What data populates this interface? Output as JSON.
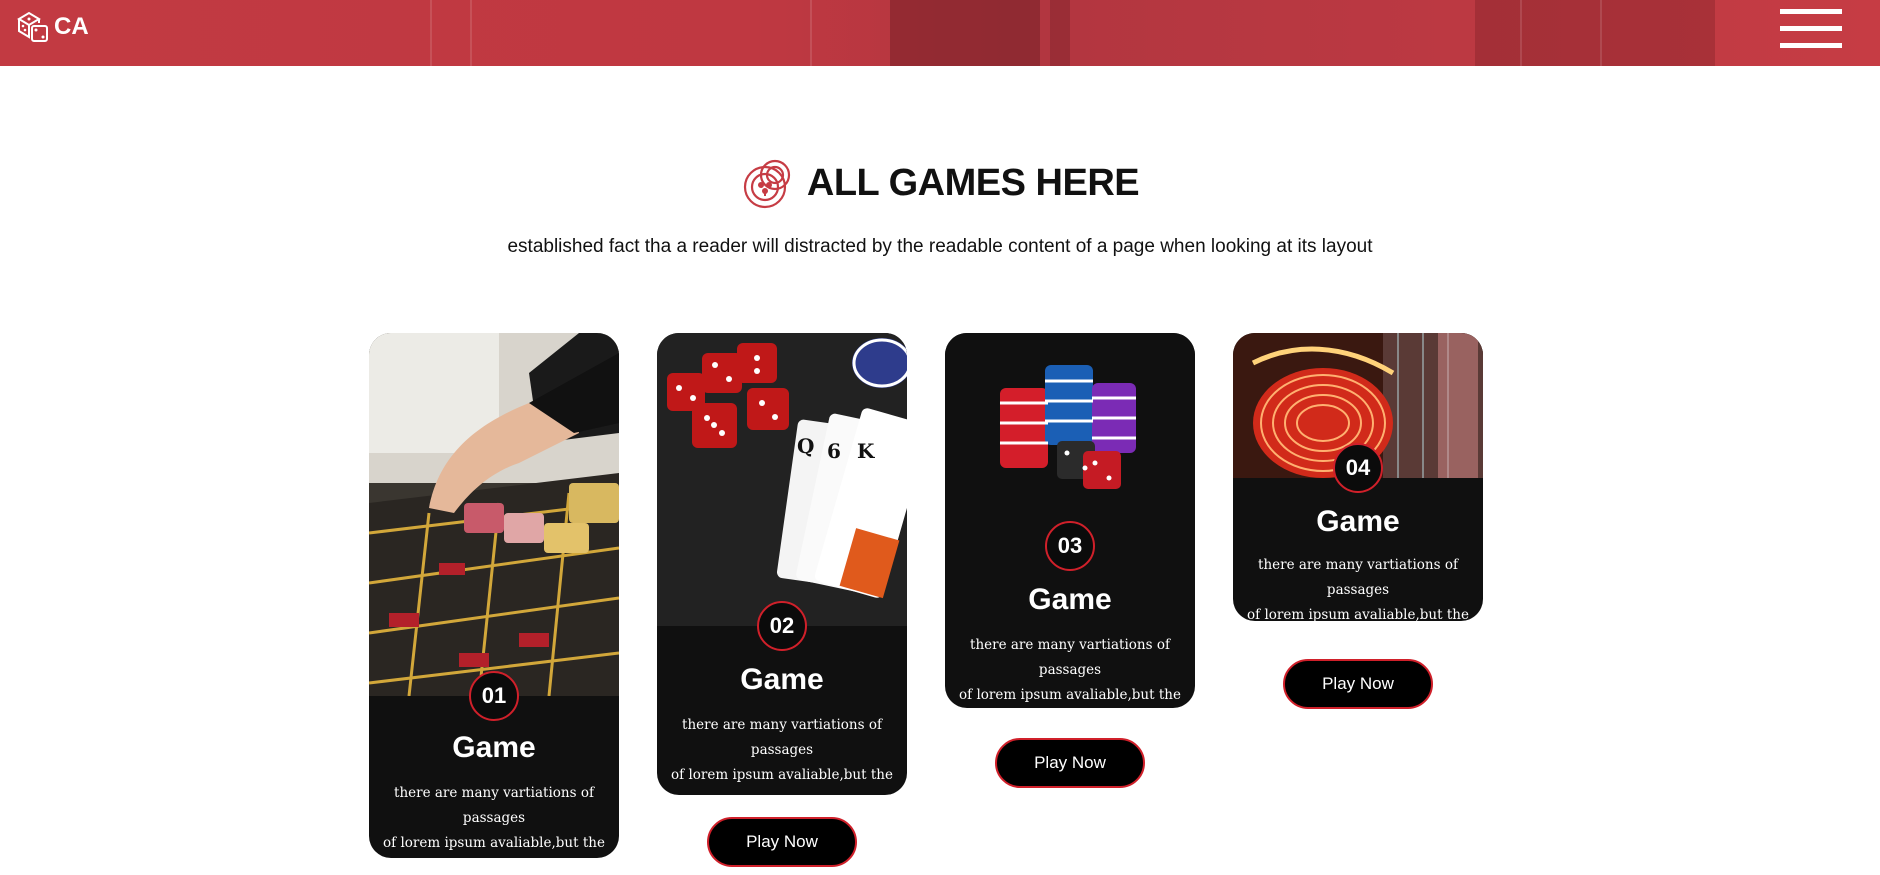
{
  "header": {
    "logo_text": "CA",
    "logo_icon": "dice-icon",
    "menu_icon": "hamburger-menu-icon"
  },
  "section": {
    "icon": "casino-chips-icon",
    "title": "ALL GAMES HERE",
    "subtitle": "established fact tha a reader will distracted by the readable content of a page when looking at its layout"
  },
  "cards": [
    {
      "number": "01",
      "title": "Game",
      "desc_line1": "there are many vartiations of passages",
      "desc_line2": "of lorem ipsum avaliable,but the",
      "button": "",
      "image": "roulette-table-image"
    },
    {
      "number": "02",
      "title": "Game",
      "desc_line1": "there are many vartiations of passages",
      "desc_line2": "of lorem ipsum avaliable,but the",
      "button": "Play Now",
      "image": "dice-and-cards-image"
    },
    {
      "number": "03",
      "title": "Game",
      "desc_line1": "there are many vartiations of passages",
      "desc_line2": "of lorem ipsum avaliable,but the",
      "button": "Play Now",
      "image": "chip-stacks-image"
    },
    {
      "number": "04",
      "title": "Game",
      "desc_line1": "there are many vartiations of passages",
      "desc_line2": "of lorem ipsum avaliable,but the",
      "button": "Play Now",
      "image": "neon-casino-sign-image"
    }
  ],
  "colors": {
    "header_red": "#c23a42",
    "card_bg": "#101010",
    "accent_red": "#d0202a"
  }
}
